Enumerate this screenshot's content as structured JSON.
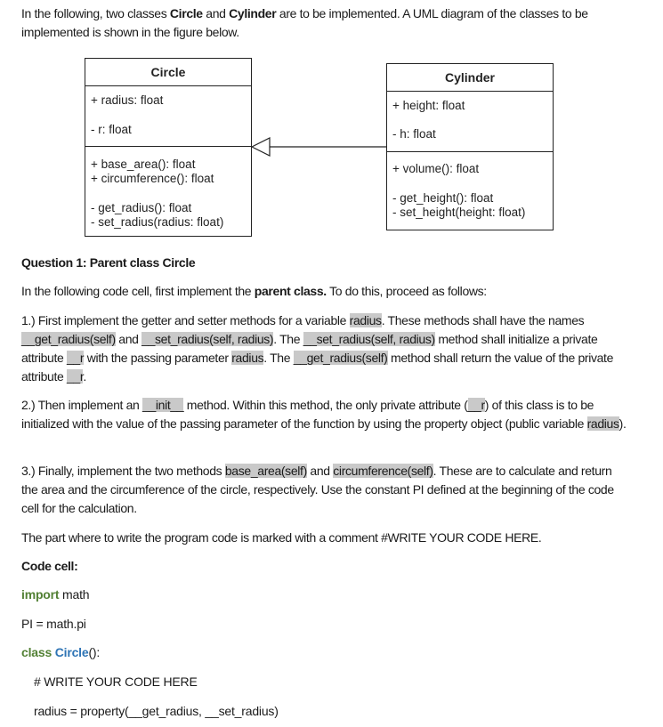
{
  "intro": {
    "t1": "In the following, two classes ",
    "b1": "Circle",
    "t2": " and ",
    "b2": "Cylinder",
    "t3": " are to be implemented. A UML diagram of the classes to be implemented is shown in the figure below."
  },
  "uml": {
    "circle": {
      "name": "Circle",
      "attributes": [
        "+ radius: float",
        "-  r: float"
      ],
      "public_methods": [
        "+ base_area(): float",
        "+ circumference(): float"
      ],
      "private_methods": [
        "- get_radius(): float",
        "- set_radius(radius: float)"
      ]
    },
    "cylinder": {
      "name": "Cylinder",
      "attributes": [
        "+ height: float",
        "- h: float"
      ],
      "public_methods": [
        "+ volume(): float"
      ],
      "private_methods": [
        "- get_height(): float",
        "- set_height(height: float)"
      ]
    },
    "relation": "inheritance"
  },
  "question": {
    "heading": "Question 1: Parent class Circle",
    "lead_t1": "In the following code cell, first implement the ",
    "lead_b": "parent class.",
    "lead_t2": " To do this, proceed as follows:",
    "step1": {
      "a": "1.) First implement the getter and setter methods for a variable ",
      "h1": "radius",
      "b": ". These methods shall have the names ",
      "h2": "__get_radius(self)",
      "c": " and ",
      "h3": "__set_radius(self, radius)",
      "d": ". The ",
      "h4": "__set_radius(self, radius)",
      "e": " method shall initialize a private attribute ",
      "h5": "__r",
      "f": " with the passing parameter ",
      "h6": "radius",
      "g": ". The ",
      "h7": "__get_radius(self)",
      "h": " method shall return the value of the private attribute ",
      "h8": "__r",
      "i": "."
    },
    "step2": {
      "a": "2.) Then implement an ",
      "h1": "__init__",
      "b": " method. Within this method, the only private attribute (",
      "h2": "__r",
      "c": ") of this class is to be initialized with the value of the passing parameter of the function by using the property object (public variable ",
      "h3": "radius",
      "d": ")."
    },
    "step3": {
      "a": "3.) Finally, implement the two methods ",
      "h1": "base_area(self)",
      "b": " and ",
      "h2": "circumference(self)",
      "c": ". These are to calculate and return the area and the circumference of the circle, respectively. Use the constant PI defined at the beginning of the code cell for the calculation."
    },
    "note": "The part where to write the program code is marked with a comment #WRITE YOUR CODE HERE."
  },
  "code": {
    "label": "Code cell:",
    "line1_kw": "import",
    "line1_rest": " math",
    "line2": "PI = math.pi",
    "line3_kw": "class",
    "line3_cls": " Circle",
    "line3_rest": "():",
    "line4": "# WRITE YOUR CODE HERE",
    "line5": "radius = property(__get_radius, __set_radius)"
  },
  "colors": {
    "highlight": "#c9c9c9",
    "keyword": "#538135",
    "class_name": "#2e74b5"
  }
}
